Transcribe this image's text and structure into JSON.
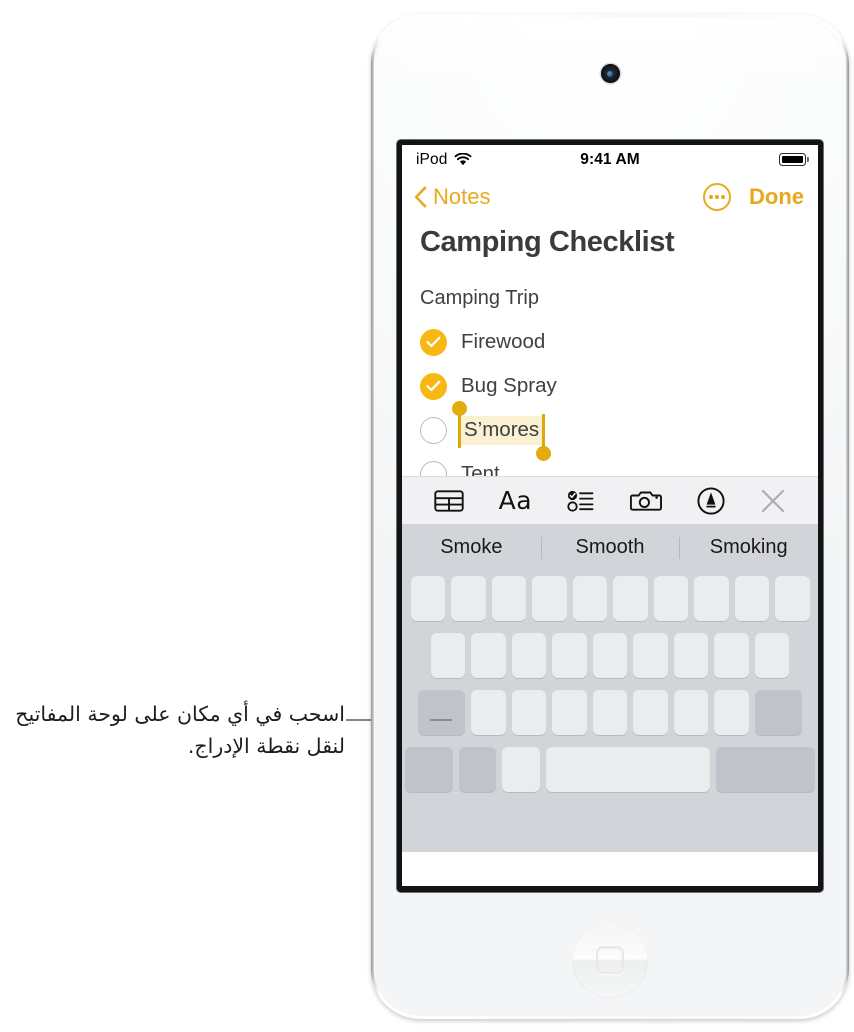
{
  "callout": {
    "text": "اسحب في أي مكان على لوحة المفاتيح لنقل نقطة الإدراج.",
    "line_color": "#848484"
  },
  "device": {
    "model_label": "iPod touch",
    "body_color": "#f7f8f9",
    "camera_icon": "front-camera-icon",
    "home_button_icon": "home-button-icon",
    "side_buttons": [
      "volume-up",
      "volume-down"
    ]
  },
  "screen": {
    "status_bar": {
      "carrier": "iPod",
      "wifi_icon": "wifi-icon",
      "time": "9:41 AM",
      "battery_icon": "battery-full-icon",
      "battery_level": 100
    },
    "nav_bar": {
      "back_icon": "chevron-left-icon",
      "back_label": "Notes",
      "more_icon": "ellipsis-circle-icon",
      "done_label": "Done",
      "accent_color": "#e8a91d"
    },
    "note": {
      "title": "Camping Checklist",
      "subtitle": "Camping Trip",
      "items": [
        {
          "label": "Firewood",
          "checked": true,
          "selected": false
        },
        {
          "label": "Bug Spray",
          "checked": true,
          "selected": false
        },
        {
          "label": "S’mores",
          "checked": false,
          "selected": true
        },
        {
          "label": "Tent",
          "checked": false,
          "selected": false
        }
      ],
      "selection_color": "#faf0d2",
      "handle_color": "#e3ab10",
      "checkbox_color": "#f9b713"
    },
    "format_toolbar": {
      "items": [
        {
          "icon": "table-icon",
          "label": "Table"
        },
        {
          "icon": "text-format-icon",
          "label": "Aa"
        },
        {
          "icon": "checklist-icon",
          "label": "Checklist"
        },
        {
          "icon": "camera-icon",
          "label": "Camera"
        },
        {
          "icon": "markup-pen-icon",
          "label": "Markup"
        },
        {
          "icon": "close-icon",
          "label": "Close"
        }
      ],
      "background": "#f1f1f4"
    },
    "predictive_bar": {
      "suggestions": [
        "Smoke",
        "Smooth",
        "Smoking"
      ],
      "background": "#d2d4d9"
    },
    "keyboard": {
      "mode": "trackpad-blank",
      "background": "#d2d4d9",
      "key_color": "#ebecee",
      "modifier_key_color": "#c0c3ca",
      "rows": [
        {
          "id": "row-1",
          "key_count": 10
        },
        {
          "id": "row-2",
          "key_count": 9
        },
        {
          "id": "row-3",
          "key_count": 9
        },
        {
          "id": "row-4",
          "key_count": 5
        }
      ]
    }
  }
}
